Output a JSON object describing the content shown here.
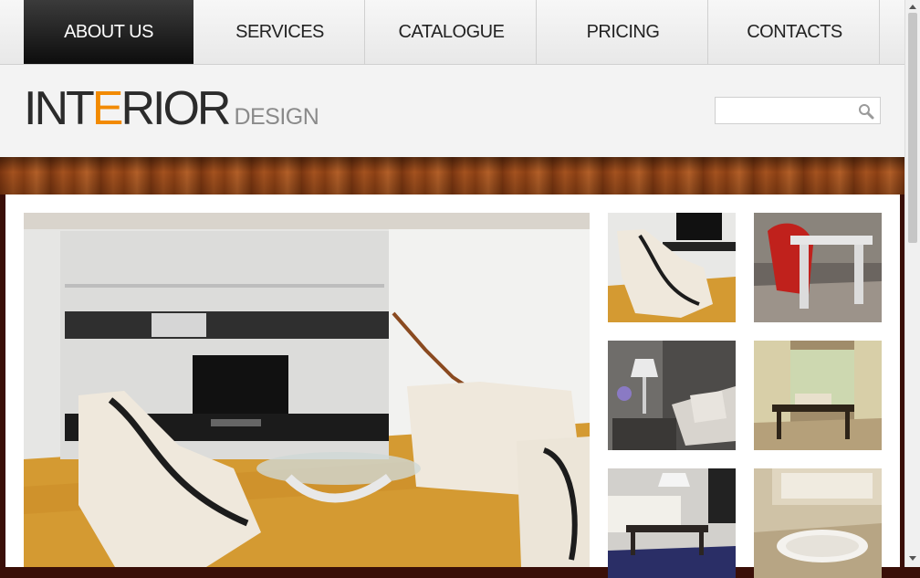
{
  "nav": {
    "items": [
      {
        "label": "ABOUT US",
        "active": true
      },
      {
        "label": "SERVICES",
        "active": false
      },
      {
        "label": "CATALOGUE",
        "active": false
      },
      {
        "label": "PRICING",
        "active": false
      },
      {
        "label": "CONTACTS",
        "active": false
      }
    ]
  },
  "logo": {
    "part1": "INT",
    "accent": "E",
    "part2": "RIOR",
    "sub": "DESIGN"
  },
  "search": {
    "value": "",
    "placeholder": "",
    "icon": "search-icon"
  },
  "colors": {
    "accent": "#f28a00",
    "nav_active": "#111111",
    "wood": "#9a4a1a"
  },
  "gallery": {
    "hero": "living-room-white-sofas-photo",
    "thumbs": [
      "white-lounge-chair-photo",
      "red-chair-table-photo",
      "bedroom-lamp-photo",
      "window-chairs-photo",
      "dining-room-photo",
      "bathroom-tub-photo"
    ]
  }
}
